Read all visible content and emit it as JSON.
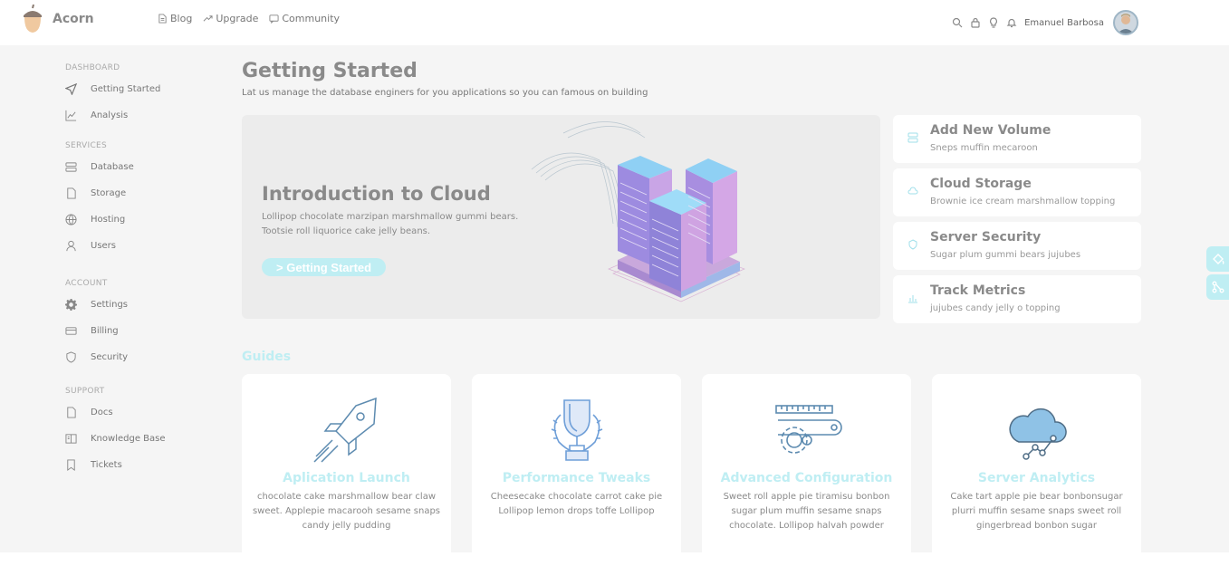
{
  "app": {
    "brand": "Acorn"
  },
  "topnav": [
    {
      "label": "Blog"
    },
    {
      "label": "Upgrade"
    },
    {
      "label": "Community"
    }
  ],
  "user": {
    "name": "Emanuel Barbosa"
  },
  "sidebar": {
    "sections": [
      {
        "title": "DASHBOARD",
        "items": [
          "Getting Started",
          "Analysis"
        ]
      },
      {
        "title": "SERVICES",
        "items": [
          "Database",
          "Storage",
          "Hosting",
          "Users"
        ]
      },
      {
        "title": "ACCOUNT",
        "items": [
          "Settings",
          "Billing",
          "Security"
        ]
      },
      {
        "title": "SUPPORT",
        "items": [
          "Docs",
          "Knowledge Base",
          "Tickets"
        ]
      }
    ]
  },
  "page": {
    "title": "Getting Started",
    "subtitle": "Lat us manage the database enginers for you applications so you can famous on building"
  },
  "hero": {
    "title": "Introduction to Cloud",
    "text": "Lollipop chocolate marzipan marshmallow gummi bears. Tootsie roll liquorice cake jelly beans.",
    "button": "> Getting Started"
  },
  "quick_links": [
    {
      "title": "Add New Volume",
      "sub": "Sneps muffin mecaroon"
    },
    {
      "title": "Cloud Storage",
      "sub": "Brownie ice cream marshmallow topping"
    },
    {
      "title": "Server Security",
      "sub": "Sugar plum gummi bears jujubes"
    },
    {
      "title": "Track Metrics",
      "sub": "jujubes candy jelly o topping"
    }
  ],
  "guides": {
    "title": "Guides",
    "items": [
      {
        "title": "Aplication Launch",
        "text": "chocolate cake marshmallow bear claw sweet. Applepie macarooh sesame snaps candy jelly pudding"
      },
      {
        "title": "Performance Tweaks",
        "text": "Cheesecake chocolate carrot cake pie Lollipop lemon drops toffe Lollipop"
      },
      {
        "title": "Advanced Configuration",
        "text": "Sweet roll apple pie tiramisu bonbon sugar plum muffin sesame snaps chocolate. Lollipop halvah powder"
      },
      {
        "title": "Server Analytics",
        "text": "Cake tart apple pie bear bonbonsugar plurri muffin sesame snaps sweet roll gingerbread bonbon sugar"
      }
    ]
  }
}
